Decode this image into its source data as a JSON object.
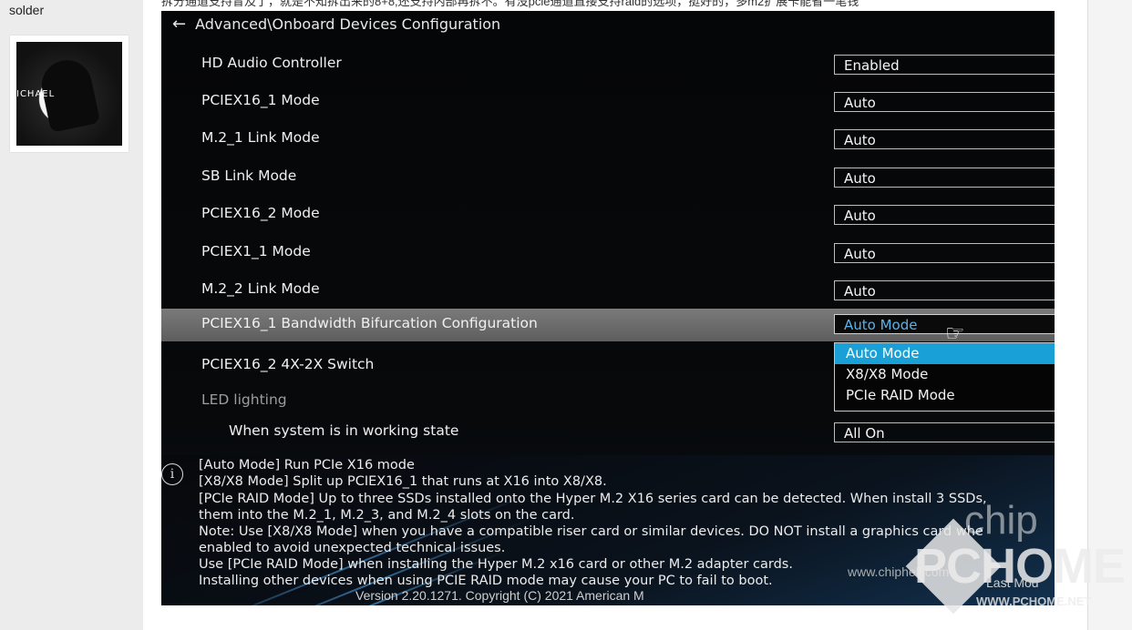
{
  "forum": {
    "username": "solder",
    "avatar_text": "ICHAEL",
    "post_text_top": "拆分通道支持冒及了，就是不知拆出来的8+8,还支持内部再拆不。有没pcie通道直接支持raid的选项，挺好的，多m2扩展卡能省一笔钱"
  },
  "bios": {
    "header": "Advanced\\Onboard Devices Configuration",
    "back_icon": "arrow-left-icon",
    "settings": [
      {
        "label": "HD Audio Controller",
        "value": "Enabled"
      },
      {
        "label": "PCIEX16_1 Mode",
        "value": "Auto"
      },
      {
        "label": "M.2_1 Link Mode",
        "value": "Auto"
      },
      {
        "label": "SB Link Mode",
        "value": "Auto"
      },
      {
        "label": "PCIEX16_2 Mode",
        "value": "Auto"
      },
      {
        "label": "PCIEX1_1 Mode",
        "value": "Auto"
      },
      {
        "label": "M.2_2 Link Mode",
        "value": "Auto"
      }
    ],
    "selected_setting": {
      "label": "PCIEX16_1 Bandwidth Bifurcation Configuration",
      "value": "Auto Mode"
    },
    "switch_label": "PCIEX16_2 4X-2X Switch",
    "led_label": "LED lighting",
    "working_state": {
      "label": "When system is in working state",
      "value": "All On"
    },
    "dropdown_options": [
      "Auto Mode",
      "X8/X8 Mode",
      "PCIe RAID Mode"
    ],
    "dropdown_active_index": 0,
    "help_lines": [
      "[Auto Mode] Run PCIe X16 mode",
      "[X8/X8 Mode] Split up PCIEX16_1 that runs at X16 into X8/X8.",
      "[PCIe RAID Mode] Up to three SSDs installed onto the Hyper M.2 X16 series card can be detected. When install 3 SSDs,",
      "them into the M.2_1, M.2_3, and M.2_4 slots on the card.",
      "Note: Use [X8/X8 Mode] when you have a compatible riser card or similar devices. DO NOT install a graphics card whe",
      "enabled to avoid unexpected technical issues.",
      "Use [PCIe RAID Mode] when installing the Hyper M.2 x16 card or other M.2 adapter cards.",
      "Installing other devices when using PCIE RAID mode may cause your PC to fail to boot."
    ],
    "version_text": "Version 2.20.1271. Copyright (C) 2021 American M",
    "last_modified": "Last Mod"
  },
  "overlay": {
    "watermark": "www.chiphell.com",
    "logo_chip": "chip",
    "logo_main": "PCHOME",
    "logo_url": "WWW.PCHOME.NET"
  },
  "colors": {
    "selection_blue": "#19a0d6",
    "selected_value_text": "#5ab3e8",
    "selected_row_gray": "#6b6b6b"
  }
}
